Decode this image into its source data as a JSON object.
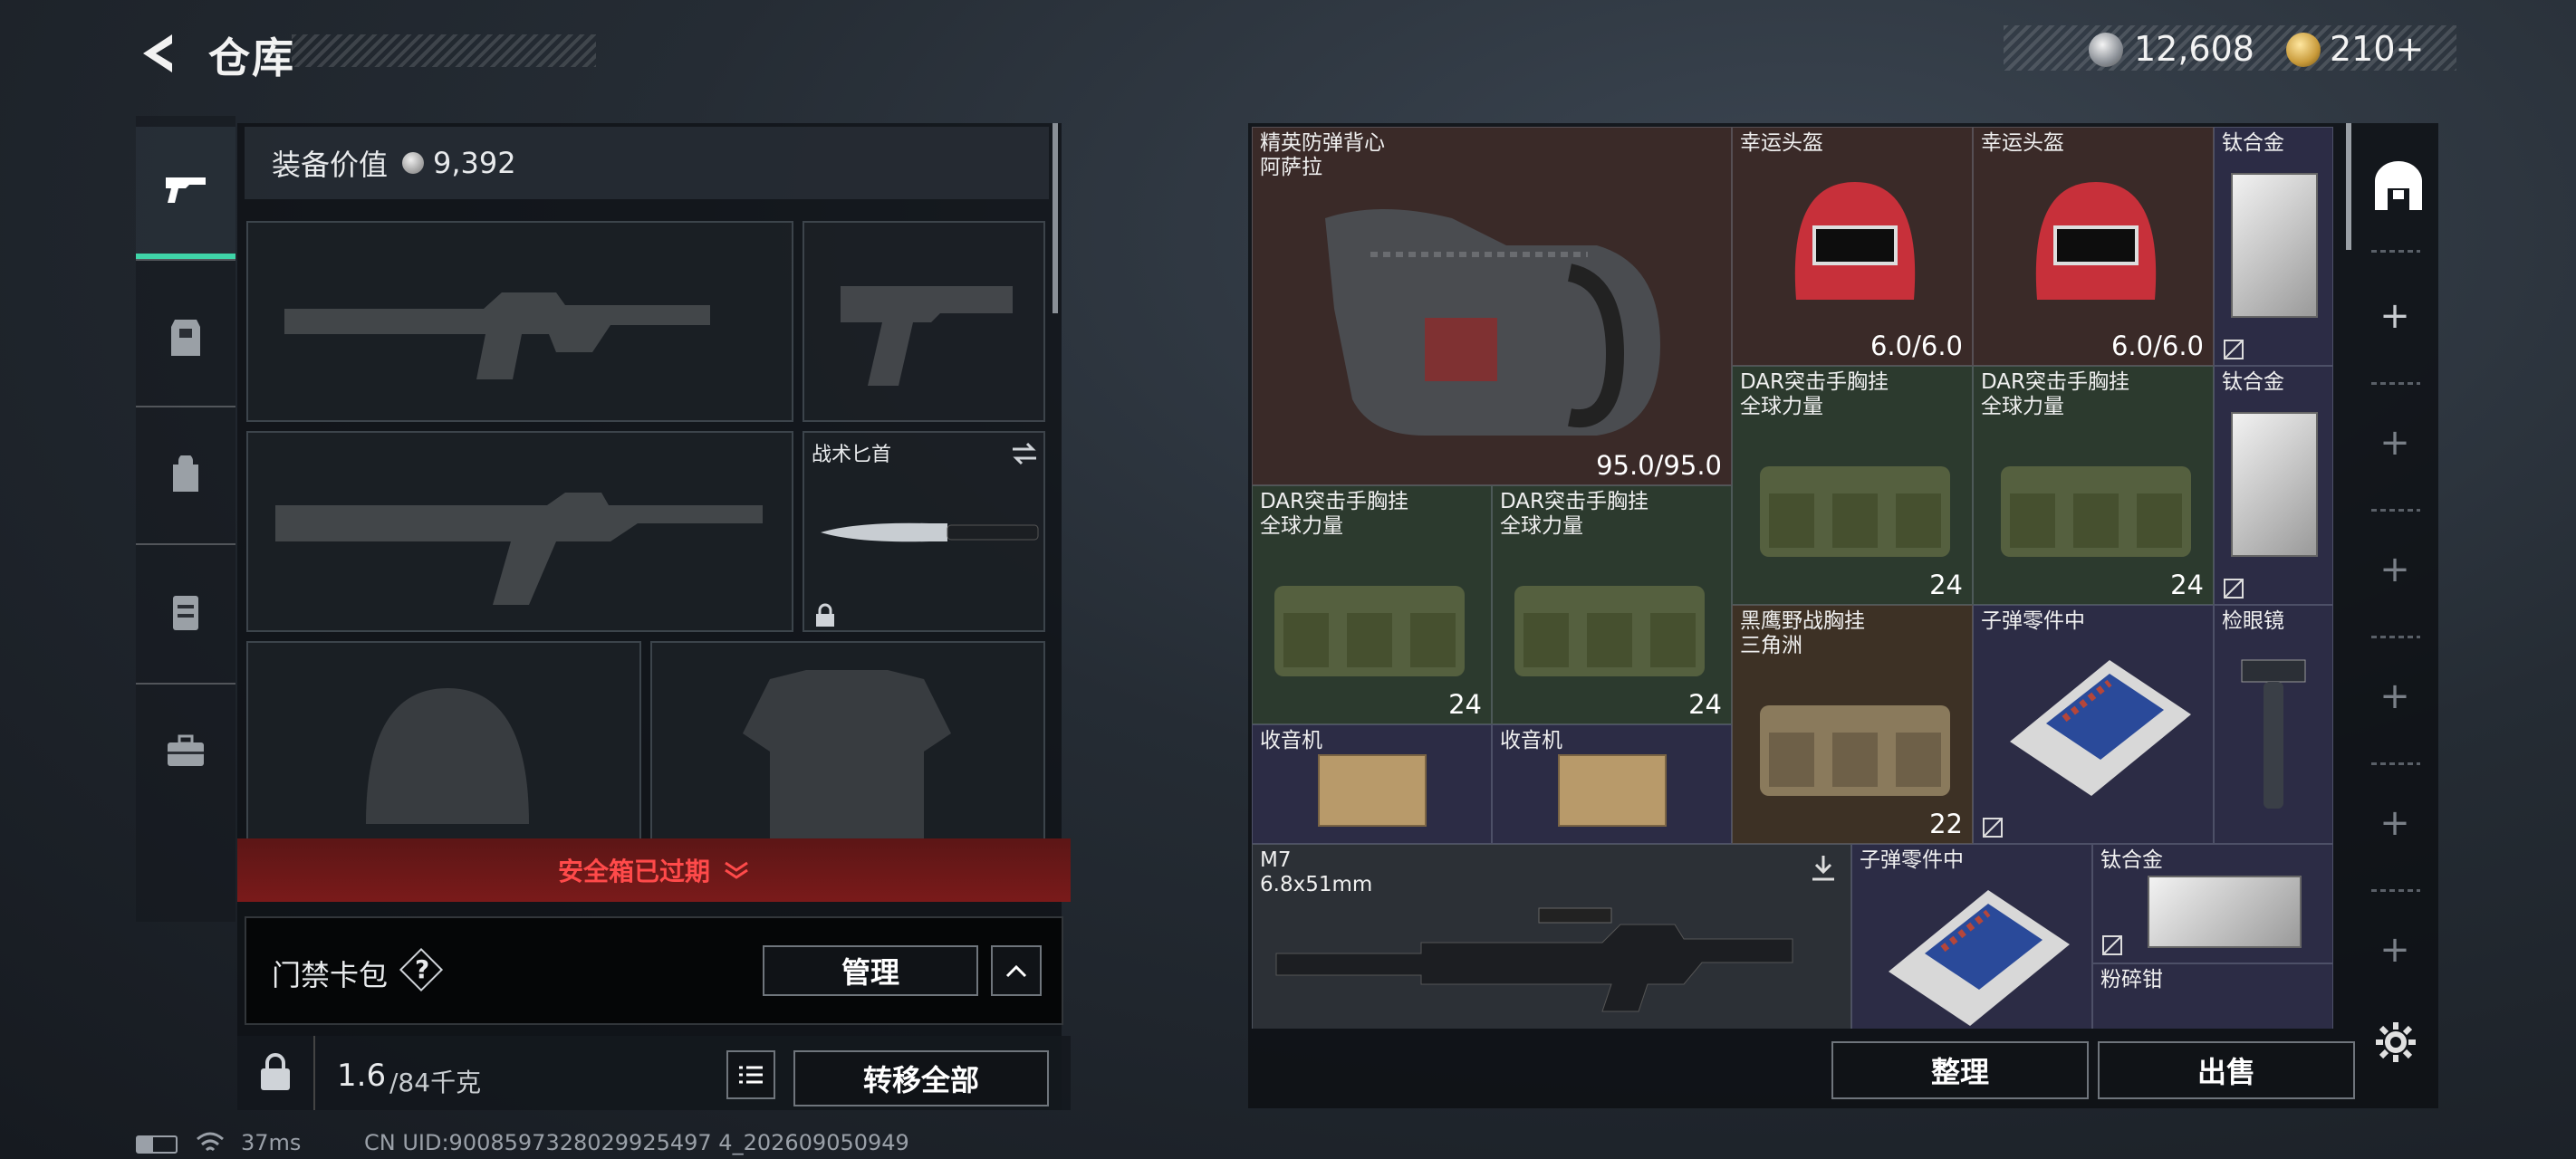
{
  "header": {
    "title": "仓库",
    "silver": "12,608",
    "gold": "210+"
  },
  "left": {
    "equip_value_label": "装备价值",
    "equip_value": "9,392",
    "knife_label": "战术匕首",
    "safe_box_text": "安全箱已过期",
    "card_pack_label": "门禁卡包",
    "help": "?",
    "manage": "管理",
    "weight_current": "1.6",
    "weight_max": "/84千克",
    "transfer_all": "转移全部"
  },
  "items": [
    {
      "line1": "精英防弹背心",
      "line2": "阿萨拉",
      "value": "95.0/95.0"
    },
    {
      "line1": "幸运头盔",
      "value": "6.0/6.0"
    },
    {
      "line1": "幸运头盔",
      "value": "6.0/6.0"
    },
    {
      "line1": "钛合金"
    },
    {
      "line1": "DAR突击手胸挂",
      "line2": "全球力量",
      "value": "24"
    },
    {
      "line1": "DAR突击手胸挂",
      "line2": "全球力量",
      "value": "24"
    },
    {
      "line1": "钛合金"
    },
    {
      "line1": "DAR突击手胸挂",
      "line2": "全球力量",
      "value": "24"
    },
    {
      "line1": "DAR突击手胸挂",
      "line2": "全球力量",
      "value": "24"
    },
    {
      "line1": "黑鹰野战胸挂",
      "line2": "三角洲",
      "value": "22"
    },
    {
      "line1": "子弹零件中"
    },
    {
      "line1": "检眼镜"
    },
    {
      "line1": "收音机"
    },
    {
      "line1": "收音机"
    },
    {
      "line1": "M7",
      "line2": "6.8x51mm"
    },
    {
      "line1": "子弹零件中"
    },
    {
      "line1": "钛合金"
    },
    {
      "line1": "粉碎钳"
    }
  ],
  "actions": {
    "sort": "整理",
    "sell": "出售"
  },
  "status": {
    "ping": "37ms",
    "uid": "CN UID:9008597328029925497 4_202609050949"
  },
  "colors": {
    "accent_green": "#3fd4a8",
    "alert_red": "#ff4a4a"
  }
}
